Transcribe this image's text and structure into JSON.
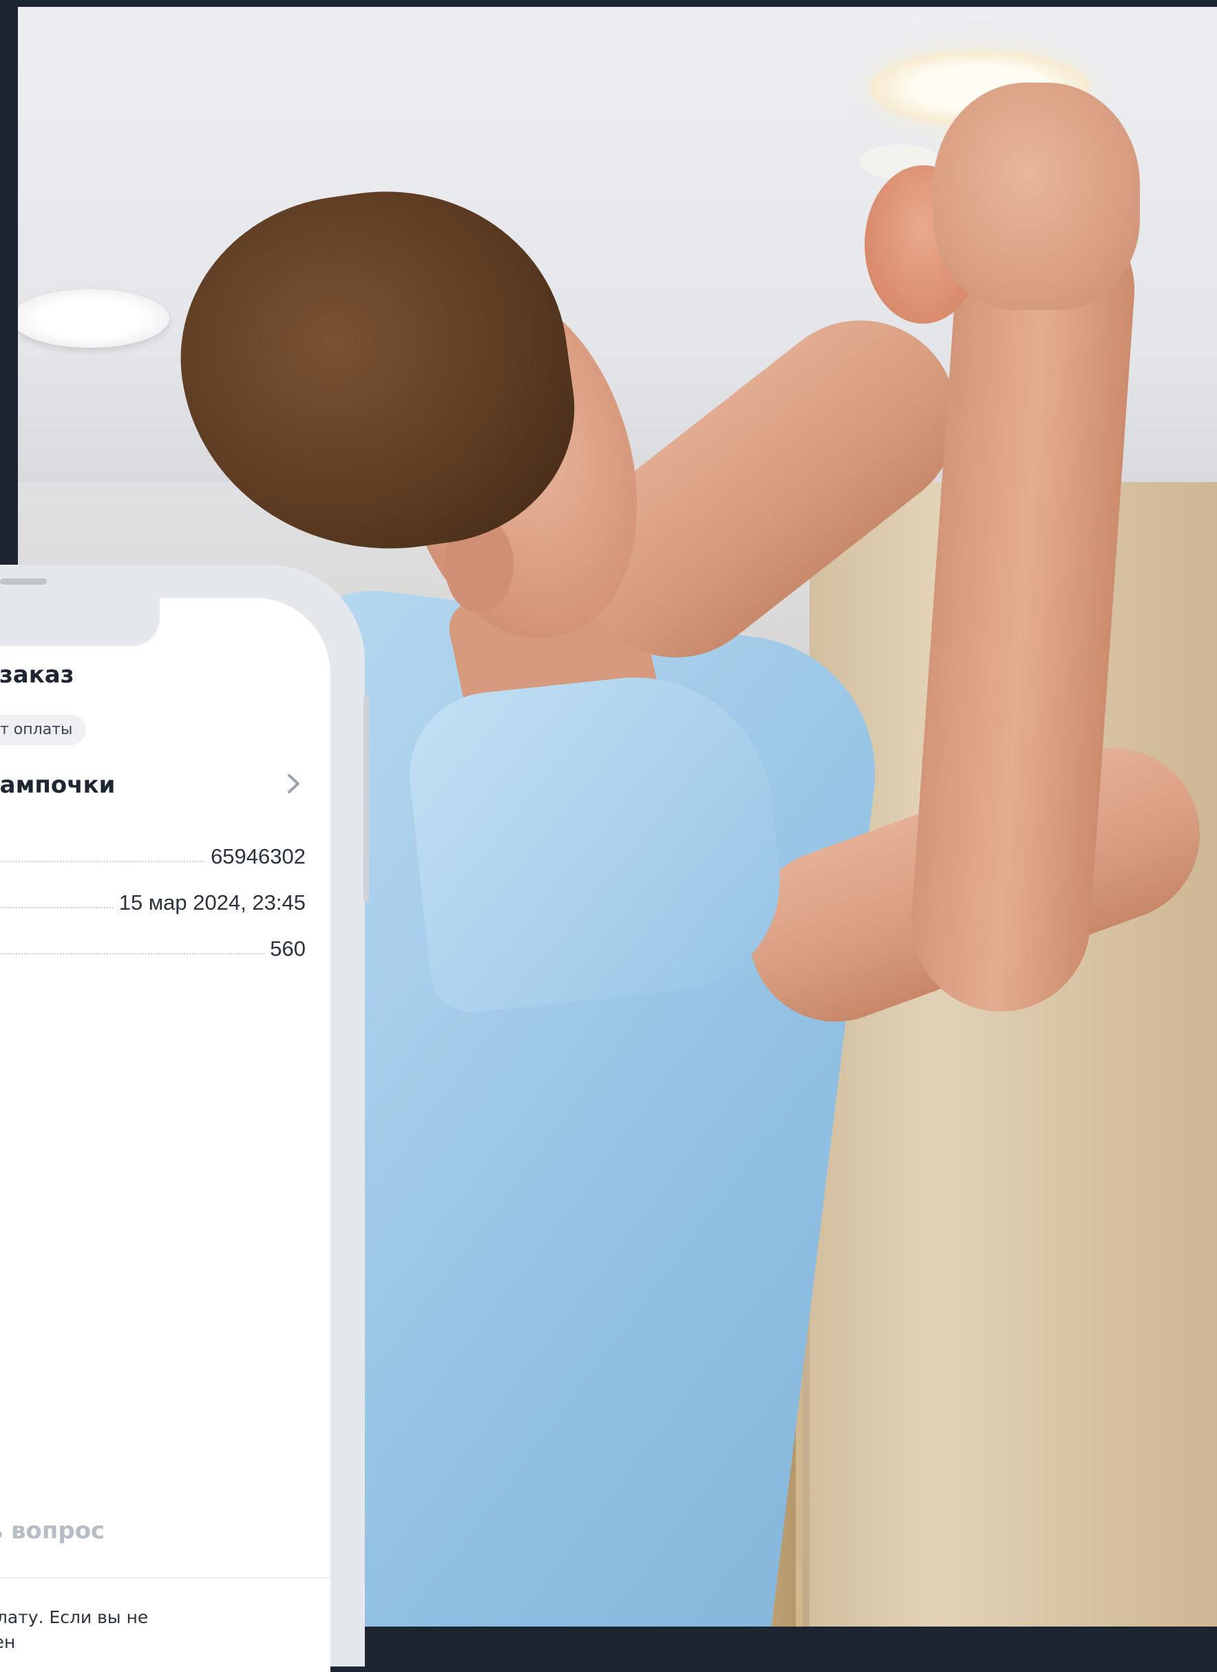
{
  "order": {
    "title": "ой заказ",
    "status": "т оплаты",
    "name": "а лампочки",
    "rows": [
      {
        "value": "65946302"
      },
      {
        "value": "15 мар 2024, 23:45"
      },
      {
        "value": "560"
      }
    ],
    "ask_link": "ать вопрос",
    "notice_line1": "а оплату. Если вы не",
    "notice_line2": "менен"
  },
  "icons": {
    "chevron": "chevron-right-icon"
  },
  "colors": {
    "page_background": "#1d2630",
    "text_dark": "#1f2733",
    "text_muted": "#b7bdc6",
    "status_pill": "#eef0f3"
  }
}
